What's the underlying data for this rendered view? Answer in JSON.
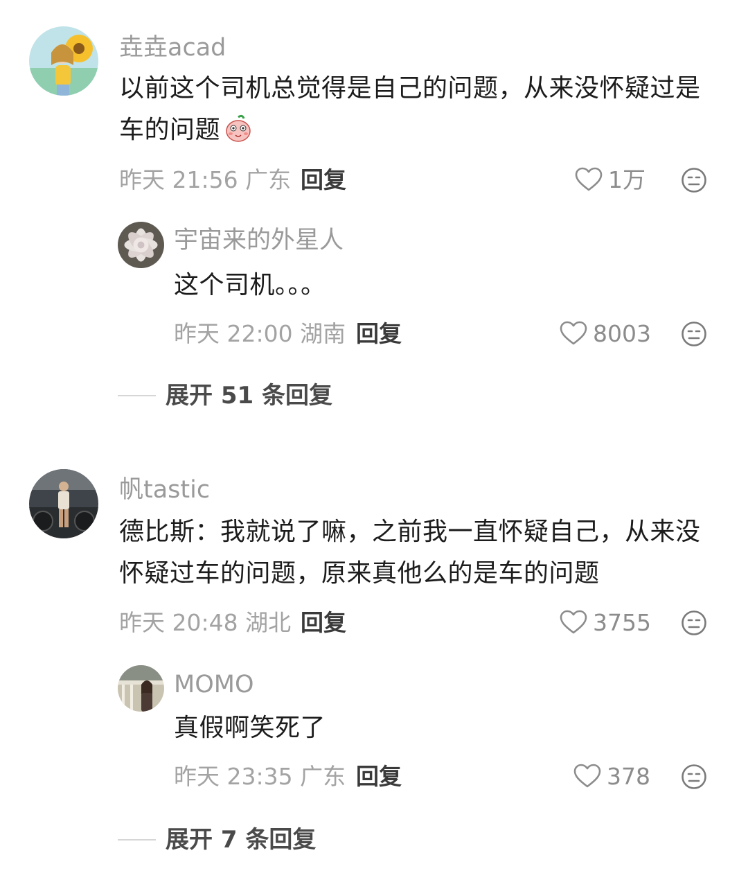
{
  "comments": [
    {
      "username": "垚垚acad",
      "text": "以前这个司机总觉得是自己的问题，从来没怀疑过是车的问题",
      "emoji": "peach-blush-emoji",
      "time": "昨天 21:56",
      "location": "广东",
      "reply_label": "回复",
      "likes": "1万",
      "reply": {
        "username": "宇宙来的外星人",
        "text": "这个司机。。。",
        "time": "昨天 22:00",
        "location": "湖南",
        "reply_label": "回复",
        "likes": "8003"
      },
      "expand_label": "展开 51 条回复"
    },
    {
      "username": "帆tastic",
      "text": "德比斯：我就说了嘛，之前我一直怀疑自己，从来没怀疑过车的问题，原来真他么的是车的问题",
      "time": "昨天 20:48",
      "location": "湖北",
      "reply_label": "回复",
      "likes": "3755",
      "reply": {
        "username": "MOMO",
        "text": "真假啊笑死了",
        "time": "昨天 23:35",
        "location": "广东",
        "reply_label": "回复",
        "likes": "378"
      },
      "expand_label": "展开 7 条回复"
    }
  ],
  "icons": {
    "like": "heart-outline-icon",
    "dislike": "meh-face-icon"
  },
  "colors": {
    "username": "#9a9a9a",
    "meta": "#a3a3a3",
    "body_text": "#1c1c1c"
  }
}
